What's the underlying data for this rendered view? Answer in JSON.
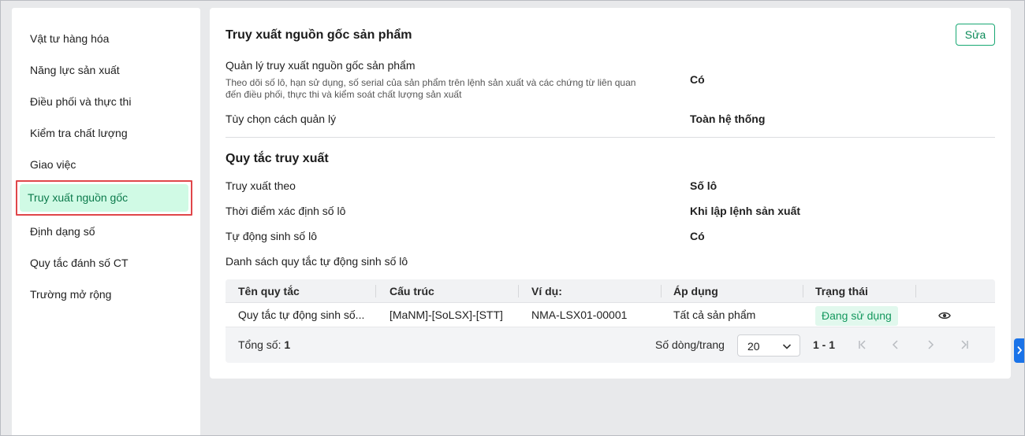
{
  "sidebar": {
    "items": [
      {
        "label": "Vật tư hàng hóa"
      },
      {
        "label": "Năng lực sản xuất"
      },
      {
        "label": "Điều phối và thực thi"
      },
      {
        "label": "Kiểm tra chất lượng"
      },
      {
        "label": "Giao việc"
      },
      {
        "label": "Truy xuất nguồn gốc",
        "active": true
      },
      {
        "label": "Định dạng số"
      },
      {
        "label": "Quy tắc đánh số CT"
      },
      {
        "label": "Trường mở rộng"
      }
    ]
  },
  "main": {
    "title": "Truy xuất nguồn gốc sản phẩm",
    "edit_label": "Sửa",
    "settings": [
      {
        "label": "Quản lý truy xuất nguồn gốc sản phẩm",
        "description": "Theo dõi số lô, hạn sử dụng, số serial của sản phẩm trên lệnh sản xuất và các chứng từ liên quan đến điều phối, thực thi và kiểm soát chất lượng sản xuất",
        "value": "Có"
      },
      {
        "label": "Tùy chọn cách quản lý",
        "value": "Toàn hệ thống"
      }
    ],
    "rules_title": "Quy tắc truy xuất",
    "rules": [
      {
        "label": "Truy xuất theo",
        "value": "Số lô"
      },
      {
        "label": "Thời điểm xác định số lô",
        "value": "Khi lập lệnh sản xuất"
      },
      {
        "label": "Tự động sinh số lô",
        "value": "Có"
      }
    ],
    "list_title": "Danh sách quy tắc tự động sinh số lô",
    "table": {
      "columns": [
        "Tên quy tắc",
        "Cấu trúc",
        "Ví dụ:",
        "Áp dụng",
        "Trạng thái"
      ],
      "rows": [
        {
          "name": "Quy tắc tự động sinh số...",
          "structure": "[MaNM]-[SoLSX]-[STT]",
          "example": "NMA-LSX01-00001",
          "apply": "Tất cả sản phẩm",
          "status": "Đang sử dụng"
        }
      ],
      "total_label": "Tổng số:",
      "total_value": "1",
      "rows_per_page_label": "Số dòng/trang",
      "rows_per_page": "20",
      "range": "1 - 1"
    }
  },
  "colors": {
    "accent": "#18a873",
    "active_bg": "#d0fae5",
    "highlight_border": "#e0464a",
    "handle": "#1a73e8"
  }
}
